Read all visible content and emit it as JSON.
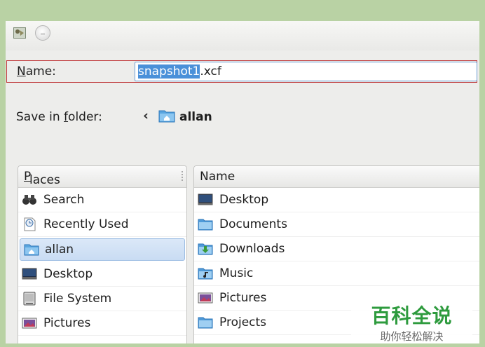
{
  "dialog": {
    "name_label_mnemonic": "N",
    "name_label_rest": "ame:",
    "filename_selected": "snapshot1",
    "filename_ext": ".xcf",
    "save_in_label_pre": "Save in ",
    "save_in_label_mnemonic": "f",
    "save_in_label_post": "older:",
    "back_glyph": "‹",
    "current_folder": "allan"
  },
  "places": {
    "header_mnemonic": "P",
    "header_rest": "laces",
    "items": [
      {
        "label": "Search",
        "icon": "binoculars-icon"
      },
      {
        "label": "Recently Used",
        "icon": "recent-document-icon"
      },
      {
        "label": "allan",
        "icon": "home-folder-icon",
        "selected": true
      },
      {
        "label": "Desktop",
        "icon": "desktop-icon"
      },
      {
        "label": "File System",
        "icon": "hard-drive-icon"
      },
      {
        "label": "Pictures",
        "icon": "pictures-folder-icon"
      }
    ]
  },
  "files": {
    "header": "Name",
    "items": [
      {
        "label": "Desktop",
        "icon": "desktop-icon"
      },
      {
        "label": "Documents",
        "icon": "folder-icon"
      },
      {
        "label": "Downloads",
        "icon": "downloads-folder-icon"
      },
      {
        "label": "Music",
        "icon": "music-folder-icon"
      },
      {
        "label": "Pictures",
        "icon": "pictures-folder-icon"
      },
      {
        "label": "Projects",
        "icon": "folder-icon"
      }
    ]
  },
  "watermark": {
    "brand": "百科全说",
    "slogan": "助你轻松解决"
  },
  "colors": {
    "background": "#b9d2a4",
    "selection": "#4a90d9",
    "name_row_border": "#c0393b",
    "watermark_brand": "#2e9b3e"
  }
}
